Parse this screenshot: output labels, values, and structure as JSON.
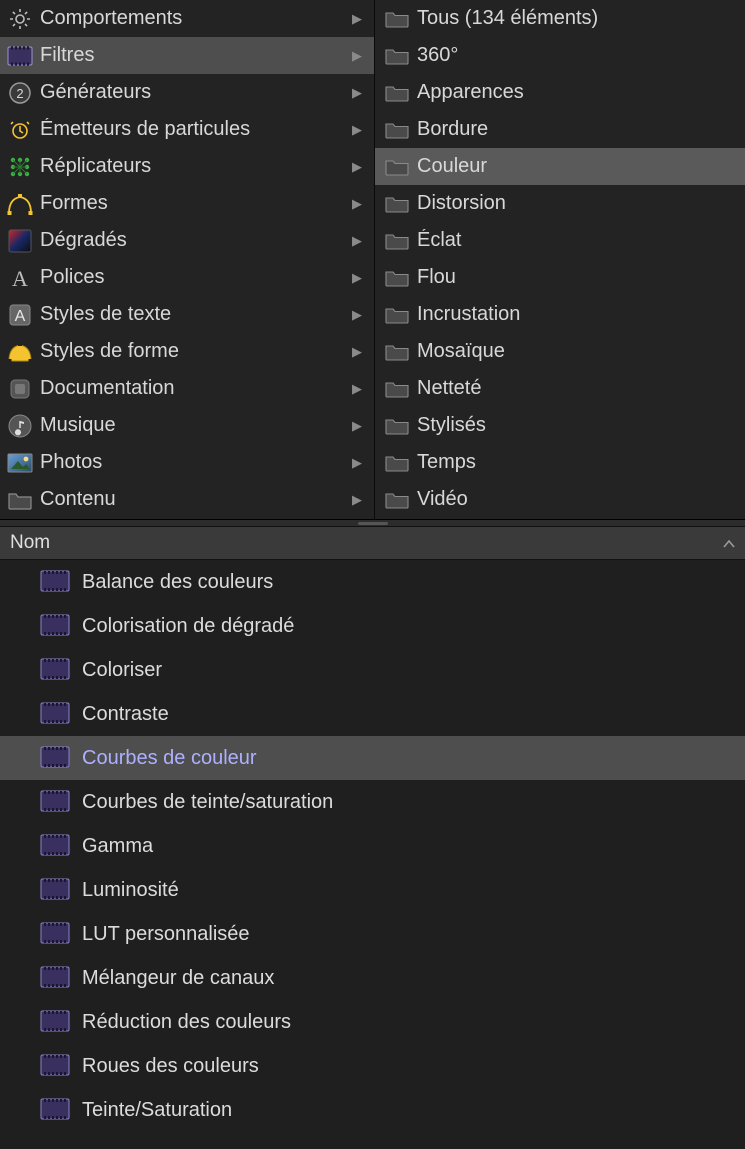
{
  "categories": [
    {
      "icon": "gear",
      "label": "Comportements"
    },
    {
      "icon": "filmstrip",
      "label": "Filtres",
      "selected": true
    },
    {
      "icon": "generator",
      "label": "Générateurs"
    },
    {
      "icon": "alarm",
      "label": "Émetteurs de particules"
    },
    {
      "icon": "replicator",
      "label": "Réplicateurs"
    },
    {
      "icon": "shape",
      "label": "Formes"
    },
    {
      "icon": "gradient",
      "label": "Dégradés"
    },
    {
      "icon": "fontA",
      "label": "Polices"
    },
    {
      "icon": "textstyle",
      "label": "Styles de texte"
    },
    {
      "icon": "shapestyle",
      "label": "Styles de forme"
    },
    {
      "icon": "doc",
      "label": "Documentation"
    },
    {
      "icon": "music",
      "label": "Musique"
    },
    {
      "icon": "photos",
      "label": "Photos"
    },
    {
      "icon": "folder",
      "label": "Contenu"
    }
  ],
  "subcategories": [
    {
      "label": "Tous (134 éléments)"
    },
    {
      "label": "360°"
    },
    {
      "label": "Apparences"
    },
    {
      "label": "Bordure"
    },
    {
      "label": "Couleur",
      "selected": true
    },
    {
      "label": "Distorsion"
    },
    {
      "label": "Éclat"
    },
    {
      "label": "Flou"
    },
    {
      "label": "Incrustation"
    },
    {
      "label": "Mosaïque"
    },
    {
      "label": "Netteté"
    },
    {
      "label": "Stylisés"
    },
    {
      "label": "Temps"
    },
    {
      "label": "Vidéo"
    }
  ],
  "list_header": {
    "label": "Nom"
  },
  "items": [
    {
      "label": "Balance des couleurs"
    },
    {
      "label": "Colorisation de dégradé"
    },
    {
      "label": "Coloriser"
    },
    {
      "label": "Contraste"
    },
    {
      "label": "Courbes de couleur",
      "selected": true
    },
    {
      "label": "Courbes de teinte/saturation"
    },
    {
      "label": "Gamma"
    },
    {
      "label": "Luminosité"
    },
    {
      "label": "LUT personnalisée"
    },
    {
      "label": "Mélangeur de canaux"
    },
    {
      "label": "Réduction des couleurs"
    },
    {
      "label": "Roues des couleurs"
    },
    {
      "label": "Teinte/Saturation"
    }
  ]
}
